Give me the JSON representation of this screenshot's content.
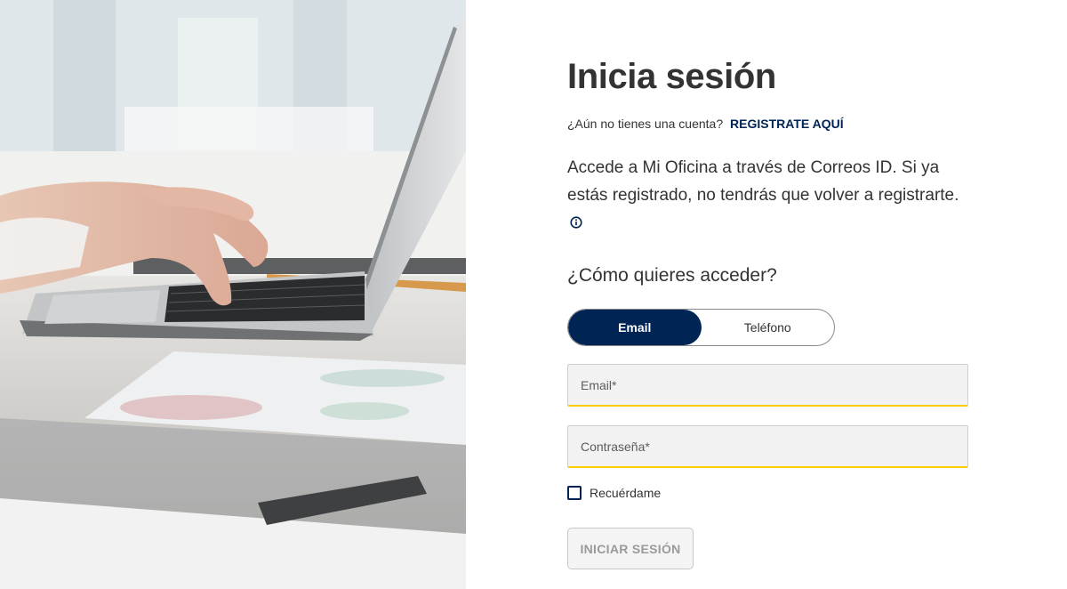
{
  "login": {
    "title": "Inicia sesión",
    "signup_prompt": "¿Aún no tienes una cuenta?",
    "signup_link": "REGISTRATE AQUÍ",
    "intro": "Accede a Mi Oficina a través de Correos ID. Si ya estás registrado, no tendrás que volver a registrarte.",
    "access_question": "¿Cómo quieres acceder?",
    "access_options": [
      {
        "label": "Email",
        "selected": true
      },
      {
        "label": "Teléfono",
        "selected": false
      }
    ],
    "email_placeholder": "Email*",
    "password_placeholder": "Contraseña*",
    "remember_label": "Recuérdame",
    "remember_checked": false,
    "submit_label": "INICIAR SESIÓN"
  },
  "icons": {
    "info": "info-circle-icon",
    "checkbox": "checkbox-unchecked"
  },
  "colors": {
    "brand_navy": "#002454",
    "field_underline": "#ffcd00",
    "text": "#333333",
    "field_bg": "#f2f2f2"
  }
}
